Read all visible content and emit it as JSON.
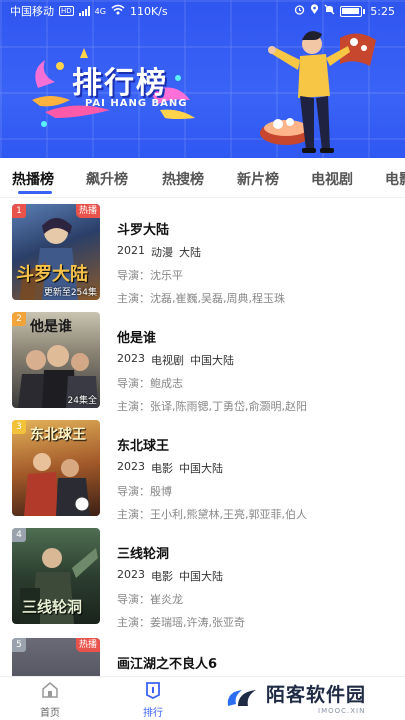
{
  "status_bar": {
    "carrier": "中国移动",
    "network_badge": "HD",
    "network": "4G",
    "speed": "110K/s",
    "time": "5:25"
  },
  "banner": {
    "title": "排行榜",
    "subtitle": "PAI HANG BANG"
  },
  "tabs": [
    {
      "label": "热播榜",
      "active": true
    },
    {
      "label": "飙升榜",
      "active": false
    },
    {
      "label": "热搜榜",
      "active": false
    },
    {
      "label": "新片榜",
      "active": false
    },
    {
      "label": "电视剧",
      "active": false
    },
    {
      "label": "电影",
      "active": false
    }
  ],
  "items": [
    {
      "rank": "1",
      "badge": "热播",
      "episode": "更新至254集",
      "art_title": "斗罗大陆",
      "title": "斗罗大陆",
      "year": "2021",
      "type": "动漫",
      "region": "大陆",
      "director_label": "导演：",
      "director": "沈乐平",
      "cast_label": "主演：",
      "cast": "沈磊,崔巍,吴磊,周典,程玉珠"
    },
    {
      "rank": "2",
      "badge": "",
      "episode": "24集全",
      "art_title": "他是谁",
      "title": "他是谁",
      "year": "2023",
      "type": "电视剧",
      "region": "中国大陆",
      "director_label": "导演：",
      "director": "鲍成志",
      "cast_label": "主演：",
      "cast": "张译,陈雨锶,丁勇岱,俞灏明,赵阳"
    },
    {
      "rank": "3",
      "badge": "",
      "episode": "",
      "art_title": "东北球王",
      "title": "东北球王",
      "year": "2023",
      "type": "电影",
      "region": "中国大陆",
      "director_label": "导演：",
      "director": "殷博",
      "cast_label": "主演：",
      "cast": "王小利,熊黛林,王亮,郭亚菲,伯人"
    },
    {
      "rank": "4",
      "badge": "",
      "episode": "",
      "art_title": "三线轮洞",
      "title": "三线轮洞",
      "year": "2023",
      "type": "电影",
      "region": "中国大陆",
      "director_label": "导演：",
      "director": "崔炎龙",
      "cast_label": "主演：",
      "cast": "姜瑞瑶,许涛,张亚奇"
    },
    {
      "rank": "5",
      "badge": "热播",
      "episode": "",
      "art_title": "",
      "title": "画江湖之不良人6",
      "year": "",
      "type": "",
      "region": "",
      "director_label": "",
      "director": "",
      "cast_label": "",
      "cast": ""
    }
  ],
  "bottom_nav": [
    {
      "label": "首页",
      "icon": "home-icon",
      "active": false
    },
    {
      "label": "排行",
      "icon": "ranking-icon",
      "active": true
    }
  ],
  "watermark": {
    "text": "陌客软件园",
    "url": "IMOOC.XIN"
  },
  "colors": {
    "accent": "#3a63f6",
    "badge": "#e8534b"
  }
}
